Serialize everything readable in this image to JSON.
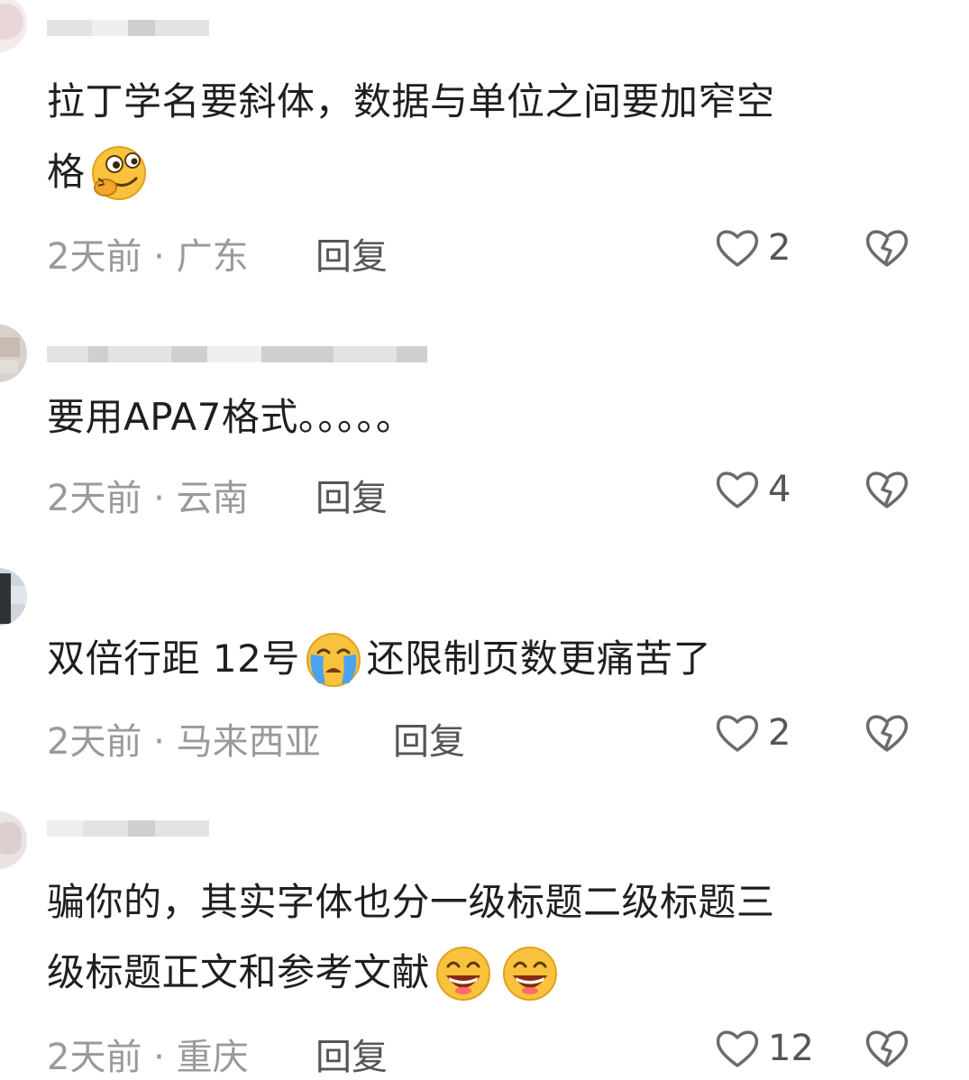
{
  "comments": [
    {
      "text_before": "拉丁学名要斜体，数据与单位之间要加窄空",
      "text_line2": "格",
      "emoji": "thinking-smirk-emoji",
      "time_location": "2天前 · 广东",
      "reply_label": "回复",
      "likes": "2"
    },
    {
      "text_before": "要用APA7格式。。。。。",
      "time_location": "2天前 · 云南",
      "reply_label": "回复",
      "likes": "4"
    },
    {
      "text_before": "双倍行距 12号",
      "emoji": "crying-emoji",
      "text_after": "还限制页数更痛苦了",
      "time_location": "2天前 · 马来西亚",
      "reply_label": "回复",
      "likes": "2"
    },
    {
      "text_before": "骗你的，其实字体也分一级标题二级标题三",
      "text_line2": "级标题正文和参考文献",
      "emoji": "grinning-emoji",
      "time_location": "2天前 · 重庆",
      "reply_label": "回复",
      "likes": "12"
    }
  ],
  "icons": {
    "like": "heart-outline-icon",
    "dislike": "broken-heart-icon"
  },
  "colors": {
    "text": "#1f1f1f",
    "meta": "#9a9a9a",
    "reply": "#555555",
    "icon": "#6b6b6b",
    "emoji_yellow": "#f9c23c"
  }
}
